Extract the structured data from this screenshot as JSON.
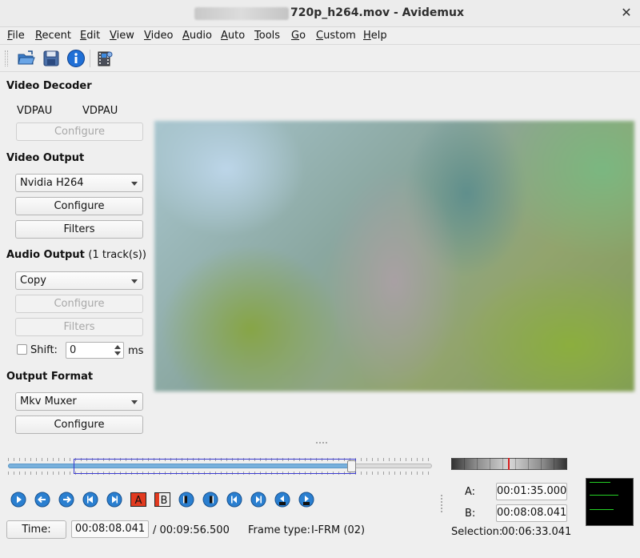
{
  "window": {
    "title_suffix": "720p_h264.mov - Avidemux",
    "close_glyph": "✕"
  },
  "menu": [
    {
      "label": "File",
      "mnemonic": "F",
      "rest": "ile"
    },
    {
      "label": "Recent",
      "mnemonic": "R",
      "rest": "ecent"
    },
    {
      "label": "Edit",
      "mnemonic": "E",
      "rest": "dit"
    },
    {
      "label": "View",
      "mnemonic": "V",
      "rest": "iew"
    },
    {
      "label": "Video",
      "mnemonic": "V",
      "rest": "ideo"
    },
    {
      "label": "Audio",
      "mnemonic": "A",
      "rest": "udio"
    },
    {
      "label": "Auto",
      "mnemonic": "A",
      "rest": "uto"
    },
    {
      "label": "Tools",
      "mnemonic": "T",
      "rest": "ools"
    },
    {
      "label": "Go",
      "mnemonic": "G",
      "rest": "o"
    },
    {
      "label": "Custom",
      "mnemonic": "C",
      "rest": "ustom"
    },
    {
      "label": "Help",
      "mnemonic": "H",
      "rest": "elp"
    }
  ],
  "toolbar": {
    "icons": [
      "open-folder-icon",
      "save-icon",
      "info-icon",
      "film-settings-icon"
    ]
  },
  "video_decoder": {
    "heading": "Video Decoder",
    "decoder_label": "VDPAU",
    "decoder_value": "VDPAU",
    "configure": "Configure"
  },
  "video_output": {
    "heading": "Video Output",
    "codec": "Nvidia H264",
    "configure": "Configure",
    "filters": "Filters"
  },
  "audio_output": {
    "heading": "Audio Output",
    "tracks": "(1 track(s))",
    "codec": "Copy",
    "configure": "Configure",
    "filters": "Filters",
    "shift_label": "Shift:",
    "shift_value": "0",
    "shift_unit": "ms"
  },
  "output_format": {
    "heading": "Output Format",
    "muxer": "Mkv Muxer",
    "configure": "Configure"
  },
  "timeline": {
    "position_fraction": 0.81,
    "selection_start_fraction": 0.155,
    "selection_end_fraction": 0.82
  },
  "nav_buttons": [
    "play-icon",
    "rewind-icon",
    "forward-icon",
    "prev-frame-icon",
    "next-frame-icon",
    "set-marker-a-icon",
    "set-marker-b-icon",
    "prev-keyframe-icon",
    "next-keyframe-icon",
    "goto-marker-a-icon",
    "goto-marker-b-icon",
    "prev-black-frame-icon",
    "next-black-frame-icon"
  ],
  "markers": {
    "a_label": "A",
    "b_label": "B"
  },
  "status": {
    "time_button": "Time:",
    "current_time": "00:08:08.041",
    "total_time": "/ 00:09:56.500",
    "frame_type_label": "Frame type:",
    "frame_type_value": "I-FRM (02)",
    "a_label": "A:",
    "a_time": "00:01:35.000",
    "b_label": "B:",
    "b_time": "00:08:08.041",
    "selection_label": "Selection:",
    "selection_time": "00:06:33.041"
  },
  "colors": {
    "accent": "#2a7fd0",
    "marker_red": "#e23a1f",
    "scope_green": "#25d025"
  }
}
